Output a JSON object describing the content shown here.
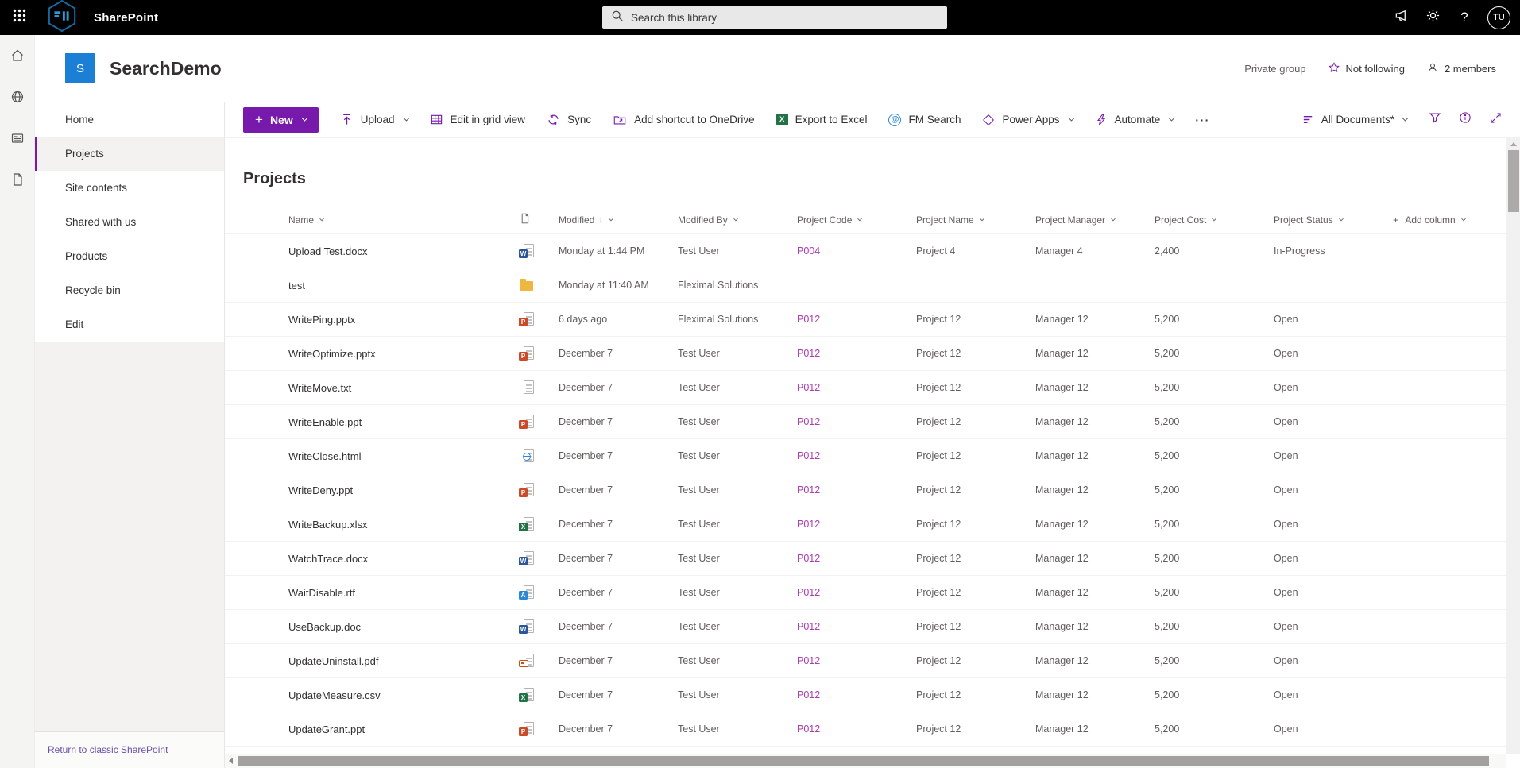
{
  "topbar": {
    "app_title": "SharePoint",
    "search_placeholder": "Search this library",
    "avatar_initials": "TU"
  },
  "site_header": {
    "site_initial": "S",
    "site_name": "SearchDemo",
    "privacy": "Private group",
    "follow_label": "Not following",
    "members_label": "2 members"
  },
  "left_nav": {
    "items": [
      "Home",
      "Projects",
      "Site contents",
      "Shared with us",
      "Products",
      "Recycle bin",
      "Edit"
    ],
    "selected": "Projects",
    "footer_link": "Return to classic SharePoint"
  },
  "command_bar": {
    "new_label": "New",
    "items": [
      {
        "label": "Upload",
        "icon": "upload",
        "chevron": true
      },
      {
        "label": "Edit in grid view",
        "icon": "grid",
        "chevron": false
      },
      {
        "label": "Sync",
        "icon": "sync",
        "chevron": false
      },
      {
        "label": "Add shortcut to OneDrive",
        "icon": "shortcut",
        "chevron": false
      },
      {
        "label": "Export to Excel",
        "icon": "excel",
        "chevron": false
      },
      {
        "label": "FM Search",
        "icon": "fm-search",
        "chevron": false
      },
      {
        "label": "Power Apps",
        "icon": "power-apps",
        "chevron": true
      },
      {
        "label": "Automate",
        "icon": "automate",
        "chevron": true
      }
    ],
    "overflow": "···",
    "view_selector": "All Documents*"
  },
  "list": {
    "title": "Projects",
    "columns": [
      {
        "label": "Name",
        "key": "name",
        "sorted": false
      },
      {
        "label": "",
        "key": "icon",
        "sorted": false
      },
      {
        "label": "Modified",
        "key": "modified",
        "sorted": true
      },
      {
        "label": "Modified By",
        "key": "modified_by",
        "sorted": false
      },
      {
        "label": "Project Code",
        "key": "code",
        "sorted": false
      },
      {
        "label": "Project Name",
        "key": "project",
        "sorted": false
      },
      {
        "label": "Project Manager",
        "key": "manager",
        "sorted": false
      },
      {
        "label": "Project Cost",
        "key": "cost",
        "sorted": false
      },
      {
        "label": "Project Status",
        "key": "status",
        "sorted": false
      },
      {
        "label": "Add column",
        "key": "add",
        "sorted": false
      }
    ],
    "rows": [
      {
        "name": "Upload Test.docx",
        "icon": "word",
        "modified": "Monday at 1:44 PM",
        "modified_by": "Test User",
        "code": "P004",
        "project": "Project 4",
        "manager": "Manager 4",
        "cost": "2,400",
        "status": "In-Progress"
      },
      {
        "name": "test",
        "icon": "folder",
        "modified": "Monday at 11:40 AM",
        "modified_by": "Fleximal Solutions",
        "code": "",
        "project": "",
        "manager": "",
        "cost": "",
        "status": ""
      },
      {
        "name": "WritePing.pptx",
        "icon": "ppt",
        "modified": "6 days ago",
        "modified_by": "Fleximal Solutions",
        "code": "P012",
        "project": "Project 12",
        "manager": "Manager 12",
        "cost": "5,200",
        "status": "Open"
      },
      {
        "name": "WriteOptimize.pptx",
        "icon": "ppt",
        "modified": "December 7",
        "modified_by": "Test User",
        "code": "P012",
        "project": "Project 12",
        "manager": "Manager 12",
        "cost": "5,200",
        "status": "Open"
      },
      {
        "name": "WriteMove.txt",
        "icon": "txt",
        "modified": "December 7",
        "modified_by": "Test User",
        "code": "P012",
        "project": "Project 12",
        "manager": "Manager 12",
        "cost": "5,200",
        "status": "Open"
      },
      {
        "name": "WriteEnable.ppt",
        "icon": "ppt",
        "modified": "December 7",
        "modified_by": "Test User",
        "code": "P012",
        "project": "Project 12",
        "manager": "Manager 12",
        "cost": "5,200",
        "status": "Open"
      },
      {
        "name": "WriteClose.html",
        "icon": "html",
        "modified": "December 7",
        "modified_by": "Test User",
        "code": "P012",
        "project": "Project 12",
        "manager": "Manager 12",
        "cost": "5,200",
        "status": "Open"
      },
      {
        "name": "WriteDeny.ppt",
        "icon": "ppt",
        "modified": "December 7",
        "modified_by": "Test User",
        "code": "P012",
        "project": "Project 12",
        "manager": "Manager 12",
        "cost": "5,200",
        "status": "Open"
      },
      {
        "name": "WriteBackup.xlsx",
        "icon": "excel",
        "modified": "December 7",
        "modified_by": "Test User",
        "code": "P012",
        "project": "Project 12",
        "manager": "Manager 12",
        "cost": "5,200",
        "status": "Open"
      },
      {
        "name": "WatchTrace.docx",
        "icon": "word",
        "modified": "December 7",
        "modified_by": "Test User",
        "code": "P012",
        "project": "Project 12",
        "manager": "Manager 12",
        "cost": "5,200",
        "status": "Open"
      },
      {
        "name": "WaitDisable.rtf",
        "icon": "rtf",
        "modified": "December 7",
        "modified_by": "Test User",
        "code": "P012",
        "project": "Project 12",
        "manager": "Manager 12",
        "cost": "5,200",
        "status": "Open"
      },
      {
        "name": "UseBackup.doc",
        "icon": "word",
        "modified": "December 7",
        "modified_by": "Test User",
        "code": "P012",
        "project": "Project 12",
        "manager": "Manager 12",
        "cost": "5,200",
        "status": "Open"
      },
      {
        "name": "UpdateUninstall.pdf",
        "icon": "pdf",
        "modified": "December 7",
        "modified_by": "Test User",
        "code": "P012",
        "project": "Project 12",
        "manager": "Manager 12",
        "cost": "5,200",
        "status": "Open"
      },
      {
        "name": "UpdateMeasure.csv",
        "icon": "csv",
        "modified": "December 7",
        "modified_by": "Test User",
        "code": "P012",
        "project": "Project 12",
        "manager": "Manager 12",
        "cost": "5,200",
        "status": "Open"
      },
      {
        "name": "UpdateGrant.ppt",
        "icon": "ppt",
        "modified": "December 7",
        "modified_by": "Test User",
        "code": "P012",
        "project": "Project 12",
        "manager": "Manager 12",
        "cost": "5,200",
        "status": "Open"
      }
    ]
  },
  "colors": {
    "topbar_black": "#000000",
    "theme_purple": "#7719aa",
    "link_purple": "#ad3bb3",
    "site_logo_blue": "#1b7fd6",
    "excel_green": "#217346",
    "word_blue": "#2b579a",
    "ppt_orange": "#cb4a28",
    "folder_amber": "#eeb73f",
    "fm_search_blue": "#2b88d8"
  }
}
